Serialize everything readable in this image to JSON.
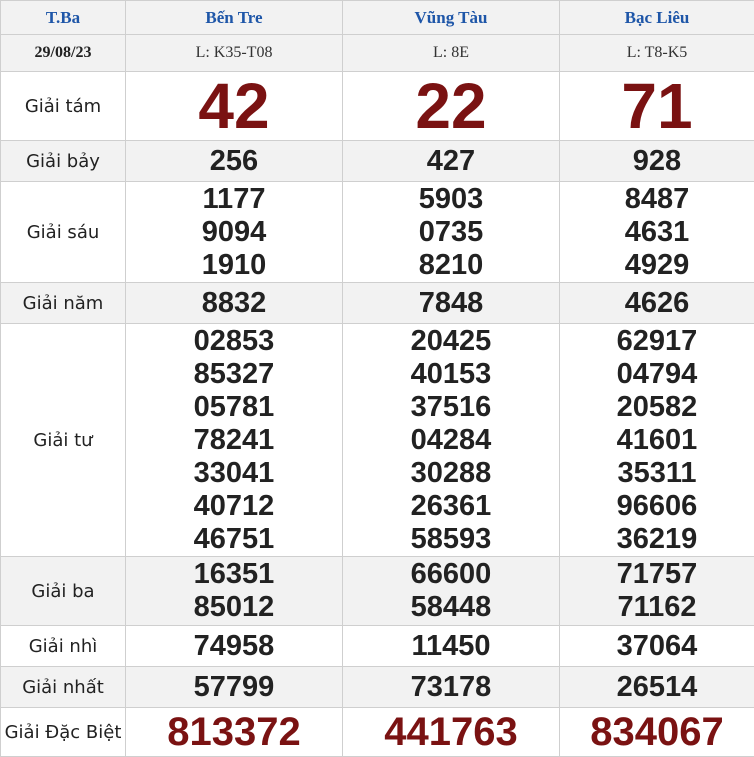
{
  "header": {
    "day": "T.Ba",
    "provinces": [
      "Bến Tre",
      "Vũng Tàu",
      "Bạc Liêu"
    ]
  },
  "subheader": {
    "date": "29/08/23",
    "codes": [
      "L: K35-T08",
      "L: 8E",
      "L: T8-K5"
    ]
  },
  "prizes": {
    "g8": {
      "label": "Giải tám",
      "values": [
        "42",
        "22",
        "71"
      ]
    },
    "g7": {
      "label": "Giải bảy",
      "values": [
        "256",
        "427",
        "928"
      ]
    },
    "g6": {
      "label": "Giải sáu",
      "values": [
        [
          "1177",
          "9094",
          "1910"
        ],
        [
          "5903",
          "0735",
          "8210"
        ],
        [
          "8487",
          "4631",
          "4929"
        ]
      ]
    },
    "g5": {
      "label": "Giải năm",
      "values": [
        "8832",
        "7848",
        "4626"
      ]
    },
    "g4": {
      "label": "Giải tư",
      "values": [
        [
          "02853",
          "85327",
          "05781",
          "78241",
          "33041",
          "40712",
          "46751"
        ],
        [
          "20425",
          "40153",
          "37516",
          "04284",
          "30288",
          "26361",
          "58593"
        ],
        [
          "62917",
          "04794",
          "20582",
          "41601",
          "35311",
          "96606",
          "36219"
        ]
      ]
    },
    "g3": {
      "label": "Giải ba",
      "values": [
        [
          "16351",
          "85012"
        ],
        [
          "66600",
          "58448"
        ],
        [
          "71757",
          "71162"
        ]
      ]
    },
    "g2": {
      "label": "Giải nhì",
      "values": [
        "74958",
        "11450",
        "37064"
      ]
    },
    "g1": {
      "label": "Giải nhất",
      "values": [
        "57799",
        "73178",
        "26514"
      ]
    },
    "db": {
      "label": "Giải Đặc Biệt",
      "values": [
        "813372",
        "441763",
        "834067"
      ]
    }
  },
  "colors": {
    "province_header": "#1e56a8",
    "highlight_number": "#7a1212",
    "shade": "#f2f2f2"
  }
}
